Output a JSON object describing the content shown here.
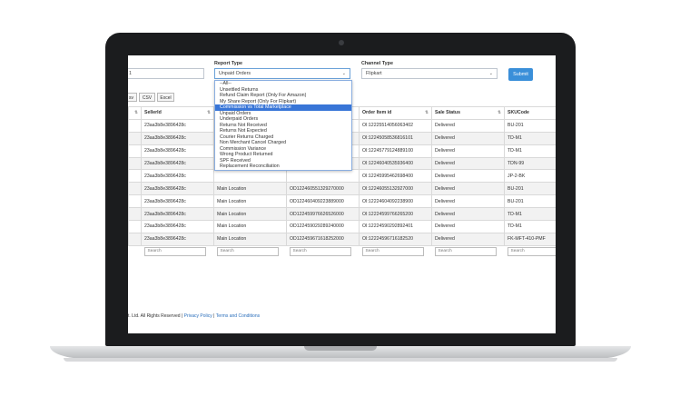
{
  "filters": {
    "report_type_label": "Report Type",
    "report_type_value": "Unpaid Orders",
    "channel_type_label": "Channel Type",
    "channel_type_value": "Flipkart",
    "left_field_value": "1",
    "submit_label": "Submit"
  },
  "export_buttons": [
    "sv",
    "CSV",
    "Excel"
  ],
  "dropdown_options": [
    "--All--",
    "Unsettled Returns",
    "Refund Claim Report (Only For Amazon)",
    "My Share Report (Only For Flipkart)",
    "Commission vs Total Marketplace",
    "Unpaid Orders",
    "Underpaid Orders",
    "Returns Not Received",
    "Returns Not Expected",
    "Courier Returns Charged",
    "Non Merchant Cancel Charged",
    "Commission Variance",
    "Wrong Product Returned",
    "SPF Received",
    "Replacement Reconciliation"
  ],
  "selected_option_index": 4,
  "table": {
    "columns": [
      "",
      "SellerId",
      "",
      "",
      "Order Item id",
      "Sale Status",
      "SKUCode"
    ],
    "rows": [
      [
        "23aa3b8e3896428c",
        "",
        "",
        "OI:12225514056063402",
        "Delivered",
        "BU-201"
      ],
      [
        "23aa3b8e3896428c",
        "",
        "",
        "OI:12245058536816101",
        "Delivered",
        "TD-M1"
      ],
      [
        "23aa3b8e3896428c",
        "",
        "",
        "OI:12245779124889100",
        "Delivered",
        "TD-M1"
      ],
      [
        "23aa3b8e3896428c",
        "",
        "",
        "OI:12246040535936400",
        "Delivered",
        "TDN-99"
      ],
      [
        "23aa3b8e3896428c",
        "",
        "",
        "OI:12245995462698400",
        "Delivered",
        "JP-2-BK"
      ],
      [
        "23aa3b8e3896428c",
        "Main Location",
        "OD122460551329270000",
        "OI:12246055132927000",
        "Delivered",
        "BU-201"
      ],
      [
        "23aa3b8e3896428c",
        "Main Location",
        "OD122460409223889000",
        "OI:12224604092238900",
        "Delivered",
        "BU-201"
      ],
      [
        "23aa3b8e3896428c",
        "Main Location",
        "OD122459976626526000",
        "OI:12224599766265200",
        "Delivered",
        "TD-M1"
      ],
      [
        "23aa3b8e3896428c",
        "Main Location",
        "OD122459029289240000",
        "OI:12224590292892401",
        "Delivered",
        "TD-M1"
      ],
      [
        "23aa3b8e3896428c",
        "Main Location",
        "OD122459671618252000",
        "OI:12224596716182520",
        "Delivered",
        "FK-MFT-410-PMF"
      ]
    ],
    "search_placeholder": "Search"
  },
  "footer": {
    "rights": "t. Ltd. All Rights Reserved |",
    "privacy": "Privacy Policy",
    "sep": "|",
    "terms": "Terms and Conditions"
  }
}
